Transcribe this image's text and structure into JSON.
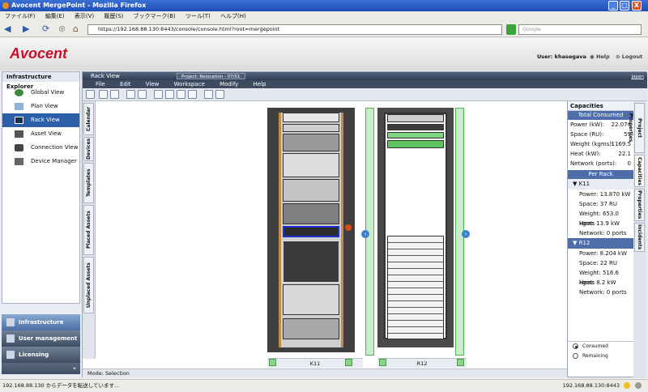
{
  "window": {
    "title": "Avocent MergePoint - Mozilla Firefox",
    "min": "_",
    "max": "□",
    "close": "X"
  },
  "menubar": [
    "ファイル(F)",
    "編集(E)",
    "表示(V)",
    "履歴(S)",
    "ブックマーク(B)",
    "ツール(T)",
    "ヘルプ(H)"
  ],
  "navbar": {
    "url": "https://192.168.88.130:8443/console/console.html?root=mergepoint",
    "search_placeholder": "Google"
  },
  "header": {
    "logo": "Avocent",
    "user_label": "User:",
    "user_name": "khasegava",
    "help": "Help",
    "logout": "Logout"
  },
  "left_panel": {
    "title": "Infrastructure Explorer",
    "items": [
      {
        "label": "Global View",
        "icon": "globe-icon"
      },
      {
        "label": "Plan View",
        "icon": "plan-icon"
      },
      {
        "label": "Rack View",
        "icon": "rack-icon",
        "selected": true
      },
      {
        "label": "Asset View",
        "icon": "asset-icon"
      },
      {
        "label": "Connection View",
        "icon": "connection-icon"
      },
      {
        "label": "Device Manager",
        "icon": "device-manager-icon"
      }
    ]
  },
  "accordion": [
    {
      "label": "Infrastructure Explo...",
      "selected": true
    },
    {
      "label": "User management"
    },
    {
      "label": "Licensing"
    }
  ],
  "accordion_more": "»",
  "rackview": {
    "title": "Rack View",
    "project": "Project: Relocation - 07/01",
    "language": "Japan",
    "menu": [
      "File",
      "Edit",
      "View",
      "Workspace",
      "Modify",
      "Help"
    ],
    "left_tabs": [
      "Calendar",
      "Devices",
      "Templates",
      "Placed Assets",
      "Unplaced Assets"
    ],
    "right_tabs": [
      "Project Properties",
      "Capacities",
      "Properties",
      "Incidents"
    ],
    "racks": [
      {
        "name": "K11"
      },
      {
        "name": "R12"
      }
    ],
    "mode": "Mode:  Selection"
  },
  "capacities": {
    "title": "Capacities",
    "total_header": "Total Consumed",
    "totals": [
      {
        "label": "Power (kW):",
        "value": "22.074"
      },
      {
        "label": "Space (RU):",
        "value": "59"
      },
      {
        "label": "Weight (kgms):",
        "value": "1169.5"
      },
      {
        "label": "Heat (kW):",
        "value": "22.1"
      },
      {
        "label": "Network (ports):",
        "value": "0"
      }
    ],
    "per_rack_header": "Per Rack",
    "per_rack": [
      {
        "name": "K11",
        "items": [
          "Power:  13.870 kW",
          "Space:  37 RU",
          "Weight:  653.0 kgms",
          "Heat:  13.9 kW",
          "Network:  0 ports"
        ]
      },
      {
        "name": "R12",
        "items": [
          "Power:  8.204 kW",
          "Space:  22 RU",
          "Weight:  516.6 kgms",
          "Heat:  8.2 kW",
          "Network:  0 ports"
        ]
      }
    ],
    "radio_consumed": "Consumed",
    "radio_remaining": "Remaining"
  },
  "status": {
    "left": "192.168.88.130 からデータを転送しています...",
    "right": "192.168.88.130:8443"
  },
  "colors": {
    "brand": "#c8102e",
    "selection": "#2d5fa8",
    "highlight": "#1a2fcf"
  }
}
